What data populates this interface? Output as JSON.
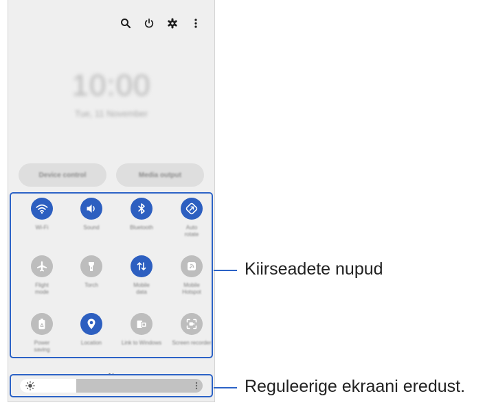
{
  "clock": {
    "time": "10:00",
    "date": "Tue, 11 November"
  },
  "header_icons": [
    "search-icon",
    "power-icon",
    "gear-icon",
    "more-vertical-icon"
  ],
  "buttons": {
    "device_control": "Device control",
    "media_output": "Media output"
  },
  "quick_settings": [
    {
      "name": "wifi",
      "label": "Wi-Fi",
      "state": "on",
      "icon": "wifi-icon"
    },
    {
      "name": "sound",
      "label": "Sound",
      "state": "on",
      "icon": "volume-icon"
    },
    {
      "name": "bluetooth",
      "label": "Bluetooth",
      "state": "on",
      "icon": "bluetooth-icon"
    },
    {
      "name": "auto-rotate",
      "label": "Auto\nrotate",
      "state": "on",
      "icon": "rotate-icon"
    },
    {
      "name": "flight-mode",
      "label": "Flight\nmode",
      "state": "off",
      "icon": "airplane-icon"
    },
    {
      "name": "torch",
      "label": "Torch",
      "state": "off",
      "icon": "torch-icon"
    },
    {
      "name": "mobile-data",
      "label": "Mobile\ndata",
      "state": "on",
      "icon": "data-transfer-icon"
    },
    {
      "name": "mobile-hotspot",
      "label": "Mobile\nHotspot",
      "state": "off",
      "icon": "hotspot-icon"
    },
    {
      "name": "power-saving",
      "label": "Power\nsaving",
      "state": "off",
      "icon": "battery-icon"
    },
    {
      "name": "location",
      "label": "Location",
      "state": "on",
      "icon": "location-pin-icon"
    },
    {
      "name": "link-to-windows",
      "label": "Link to Windows",
      "state": "off",
      "icon": "link-windows-icon"
    },
    {
      "name": "screen-recorder",
      "label": "Screen recorder",
      "state": "off",
      "icon": "screen-recorder-icon"
    }
  ],
  "page_indicator": {
    "pages": 2,
    "current": 1
  },
  "brightness": {
    "level": 0.31,
    "icon": "sun-icon",
    "menu_icon": "more-vertical-icon"
  },
  "callouts": {
    "quick_settings": "Kiirseadete nupud",
    "brightness": "Reguleerige ekraani eredust."
  },
  "colors": {
    "accent": "#2d5fc0",
    "callout_line": "#2b62c6",
    "tile_off": "#bdbdbd",
    "panel_bg": "#efefef"
  }
}
